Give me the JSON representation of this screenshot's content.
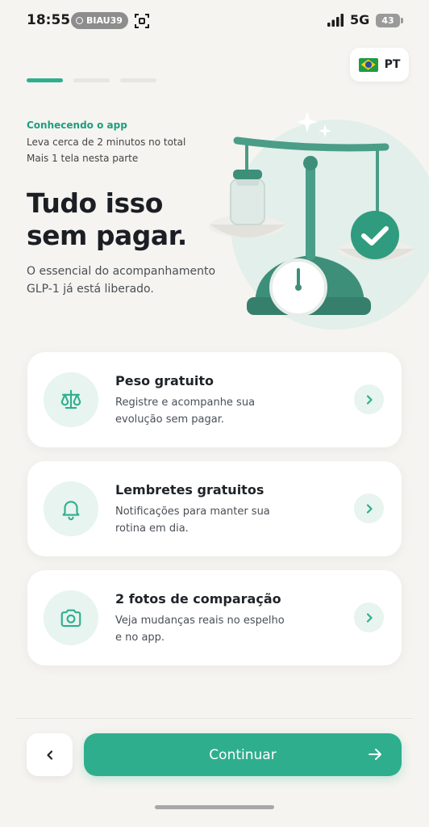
{
  "status_bar": {
    "time": "18:55",
    "carrier_badge": "BIAU39",
    "network": "5G",
    "battery": "43"
  },
  "header": {
    "language_code": "PT",
    "language_flag": "brazil-flag",
    "progress": {
      "total_steps": 3,
      "current_step": 1
    }
  },
  "intro": {
    "kicker": "Conhecendo o app",
    "meta_line_1": "Leva cerca de 2 minutos no total",
    "meta_line_2": "Mais 1 tela nesta parte",
    "title": "Tudo isso sem pagar.",
    "description": "O essencial do acompanhamento GLP-1 já está liberado."
  },
  "features": [
    {
      "icon": "scale-icon",
      "title": "Peso gratuito",
      "description": "Registre e acompanhe sua evolução sem pagar."
    },
    {
      "icon": "bell-icon",
      "title": "Lembretes gratuitos",
      "description": "Notificações para manter sua rotina em dia."
    },
    {
      "icon": "camera-icon",
      "title": "2 fotos de comparação",
      "description": "Veja mudanças reais no espelho e no app."
    }
  ],
  "footer": {
    "continue_label": "Continuar"
  },
  "colors": {
    "accent": "#2fae8e",
    "accent_soft": "#e7f4ef",
    "background": "#f5f4f0"
  }
}
